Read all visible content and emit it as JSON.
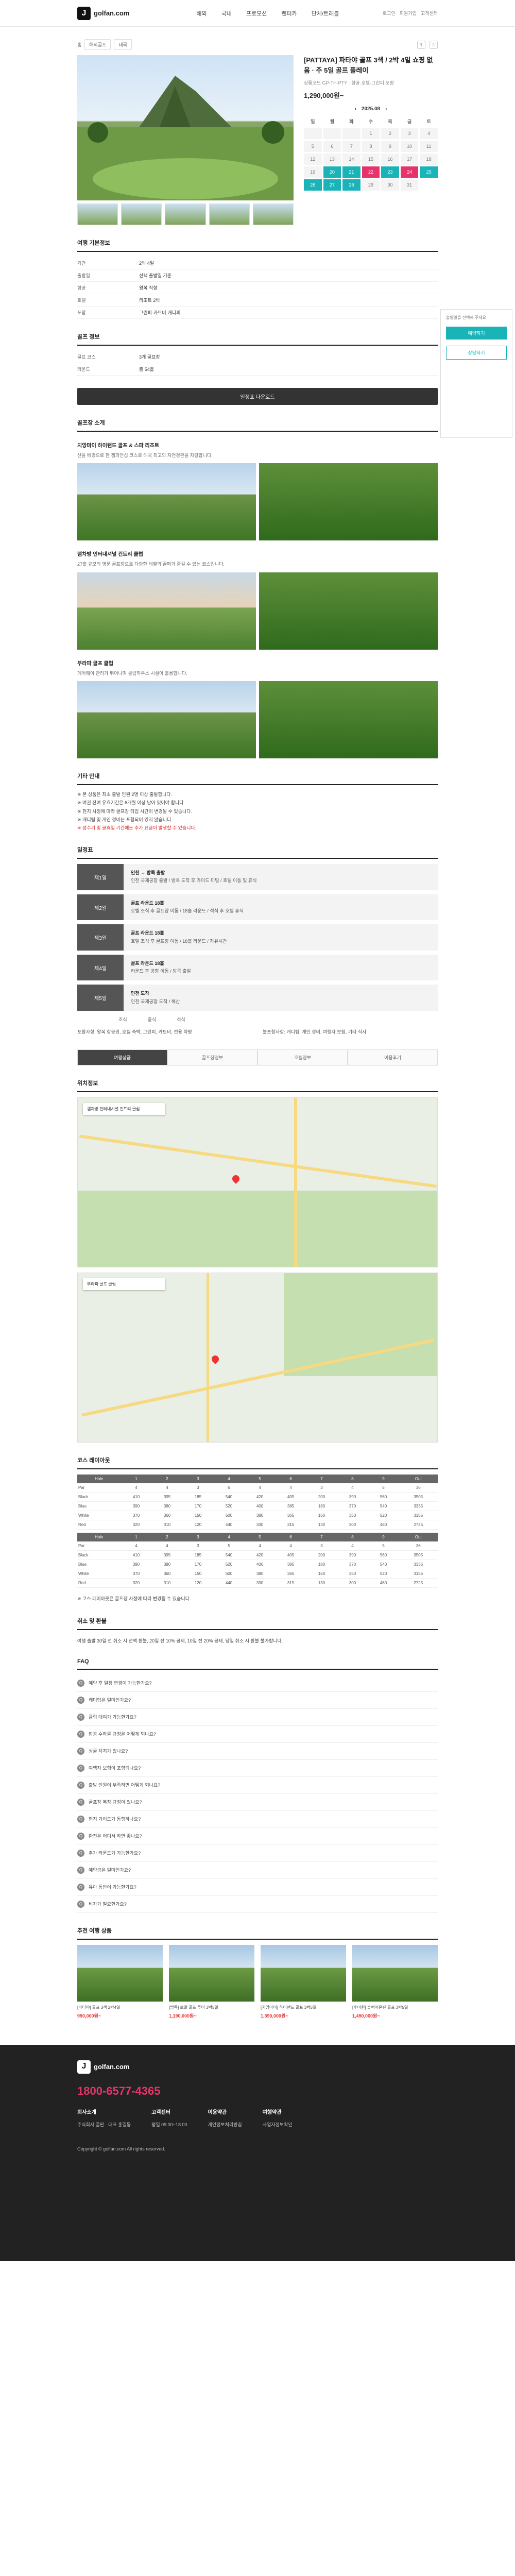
{
  "header": {
    "brand": "golfan.com",
    "logo_glyph": "J",
    "nav": [
      "해외",
      "국내",
      "프로모션",
      "렌터카",
      "단체/트래블"
    ],
    "right_links": [
      "로그인",
      "회원가입",
      "고객센터"
    ]
  },
  "crumb": {
    "home": "홈",
    "cat1": "해외골프",
    "cat2": "태국"
  },
  "product": {
    "title": "[PATTAYA] 파타야 골프 3색 / 2박 4일 쇼핑 없음 · 주 5일 골프 플레이",
    "subtitle": "상품코드 GP-TH-PTY · 항공·호텔·그린피 포함",
    "price": "1,290,000원~",
    "calendar_month": "2025.08",
    "weekday_labels": [
      "일",
      "월",
      "화",
      "수",
      "목",
      "금",
      "토"
    ]
  },
  "side_box": {
    "label": "출발일을 선택해 주세요",
    "button": "예약하기",
    "sub": "상담하기"
  },
  "basic": {
    "title": "여행 기본정보",
    "rows": [
      [
        "기간",
        "2박 4일"
      ],
      [
        "출발일",
        "선택 출발일 기준"
      ],
      [
        "항공",
        "왕복 직항"
      ],
      [
        "호텔",
        "리조트 2박"
      ],
      [
        "포함",
        "그린피·카트비·캐디피"
      ]
    ]
  },
  "golf_info": {
    "title": "골프 정보",
    "rows": [
      [
        "골프 코스",
        "3개 골프장"
      ],
      [
        "라운드",
        "총 54홀"
      ]
    ]
  },
  "download": "일정표 다운로드",
  "courses": {
    "title": "골프장 소개",
    "items": [
      {
        "name": "치앙마이 하이랜드 골프 & 스파 리조트",
        "desc": "산을 배경으로 한 챔피언십 코스로 태국 최고의 자연경관을 자랑합니다."
      },
      {
        "name": "램차방 인터내셔널 컨트리 클럽",
        "desc": "27홀 규모의 명문 골프장으로 다양한 레벨의 골퍼가 즐길 수 있는 코스입니다."
      },
      {
        "name": "부라파 골프 클럽",
        "desc": "페어웨이 관리가 뛰어나며 클럽하우스 시설이 훌륭합니다."
      }
    ]
  },
  "notes": {
    "title": "기타 안내",
    "lines": [
      "※ 본 상품은 최소 출발 인원 2명 이상 출발합니다.",
      "※ 여권 잔여 유효기간은 6개월 이상 남아 있어야 합니다.",
      "※ 현지 사정에 따라 골프장 티업 시간이 변경될 수 있습니다.",
      "※ 캐디팁 및 개인 경비는 포함되어 있지 않습니다."
    ],
    "warn": "※ 성수기 및 공휴일 기간에는 추가 요금이 발생할 수 있습니다."
  },
  "itinerary": {
    "title": "일정표",
    "days": [
      {
        "label": "제1일",
        "title": "인천 → 방콕 출발",
        "detail": "인천 국제공항 출발 / 방콕 도착 후 가이드 미팅 / 호텔 이동 및 휴식"
      },
      {
        "label": "제2일",
        "title": "골프 라운드 18홀",
        "detail": "호텔 조식 후 골프장 이동 / 18홀 라운드 / 석식 후 호텔 휴식"
      },
      {
        "label": "제3일",
        "title": "골프 라운드 18홀",
        "detail": "호텔 조식 후 골프장 이동 / 18홀 라운드 / 자유시간"
      },
      {
        "label": "제4일",
        "title": "골프 라운드 18홀",
        "detail": "라운드 후 공항 이동 / 방콕 출발"
      },
      {
        "label": "제5일",
        "title": "인천 도착",
        "detail": "인천 국제공항 도착 / 해산"
      }
    ]
  },
  "legend": [
    "조식",
    "중식",
    "석식"
  ],
  "include": {
    "left": "포함사항: 왕복 항공권, 호텔 숙박, 그린피, 카트비, 전용 차량",
    "right": "불포함사항: 캐디팁, 개인 경비, 여행자 보험, 기타 식사"
  },
  "tabs": [
    "여행상품",
    "골프장정보",
    "호텔정보",
    "이용후기"
  ],
  "maps": {
    "title": "위치정보",
    "card1": "램차방 인터내셔널 컨트리 클럽",
    "card2": "부라파 골프 클럽"
  },
  "score": {
    "title": "코스 레이아웃",
    "headers": [
      "Hole",
      "1",
      "2",
      "3",
      "4",
      "5",
      "6",
      "7",
      "8",
      "9",
      "Out"
    ],
    "rows": [
      [
        "Par",
        "4",
        "4",
        "3",
        "5",
        "4",
        "4",
        "3",
        "4",
        "5",
        "36"
      ],
      [
        "Black",
        "410",
        "395",
        "185",
        "540",
        "420",
        "405",
        "200",
        "390",
        "560",
        "3505"
      ],
      [
        "Blue",
        "390",
        "380",
        "170",
        "520",
        "400",
        "385",
        "180",
        "370",
        "540",
        "3335"
      ],
      [
        "White",
        "370",
        "360",
        "150",
        "500",
        "380",
        "365",
        "160",
        "350",
        "520",
        "3155"
      ],
      [
        "Red",
        "320",
        "310",
        "120",
        "440",
        "330",
        "315",
        "130",
        "300",
        "460",
        "2725"
      ]
    ]
  },
  "score_note": "※ 코스 레이아웃은 골프장 사정에 따라 변경될 수 있습니다.",
  "refund": {
    "title": "취소 및 환불",
    "text": "여행 출발 30일 전 취소 시 전액 환불, 20일 전 10% 공제, 10일 전 20% 공제, 당일 취소 시 환불 불가합니다."
  },
  "faq": {
    "title": "FAQ",
    "items": [
      "예약 후 일정 변경이 가능한가요?",
      "캐디팁은 얼마인가요?",
      "클럽 대여가 가능한가요?",
      "항공 수하물 규정은 어떻게 되나요?",
      "싱글 차지가 있나요?",
      "여행자 보험이 포함되나요?",
      "출발 인원이 부족하면 어떻게 되나요?",
      "골프장 복장 규정이 있나요?",
      "현지 가이드가 동행하나요?",
      "환전은 어디서 하면 좋나요?",
      "추가 라운드가 가능한가요?",
      "예약금은 얼마인가요?",
      "유아 동반이 가능한가요?",
      "비자가 필요한가요?"
    ]
  },
  "related": {
    "title": "추천 여행 상품",
    "items": [
      {
        "name": "[파타야] 골프 3색 2박4일",
        "price": "990,000원~"
      },
      {
        "name": "[방콕] 로얄 골프 투어 3박5일",
        "price": "1,190,000원~"
      },
      {
        "name": "[치앙마이] 하이랜드 골프 3박5일",
        "price": "1,390,000원~"
      },
      {
        "name": "[후아힌] 블랙마운틴 골프 3박5일",
        "price": "1,490,000원~"
      }
    ]
  },
  "footer": {
    "brand": "golfan.com",
    "tel": "1800-6577-4365",
    "cols": [
      {
        "h": "회사소개",
        "t": "주식회사 골판 · 대표 홍길동"
      },
      {
        "h": "고객센터",
        "t": "평일 09:00~18:00"
      },
      {
        "h": "이용약관",
        "t": "개인정보처리방침"
      },
      {
        "h": "여행약관",
        "t": "사업자정보확인"
      }
    ],
    "copy": "Copyright © golfan.com All rights reserved."
  }
}
